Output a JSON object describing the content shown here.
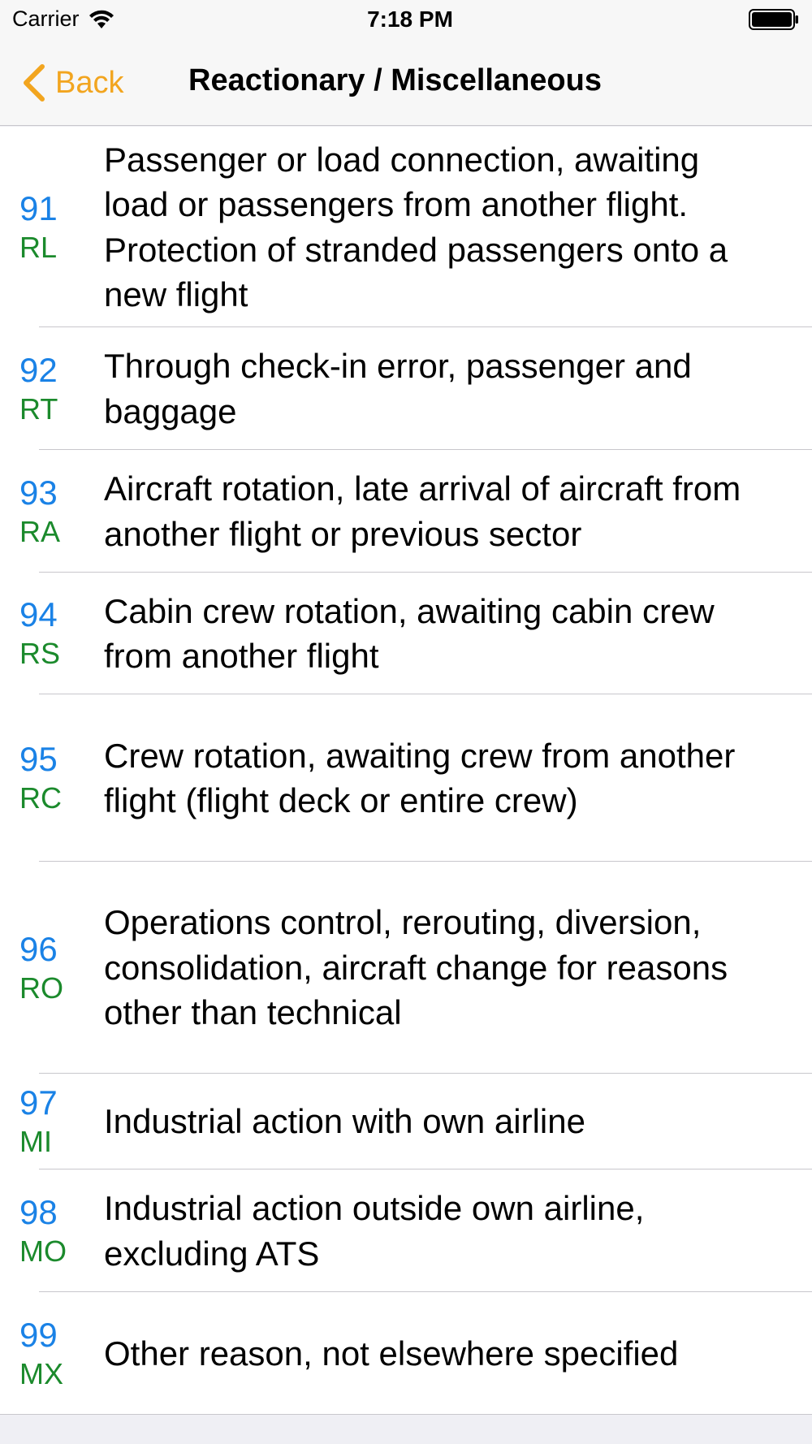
{
  "status_bar": {
    "carrier": "Carrier",
    "time": "7:18 PM",
    "icons": [
      "wifi-icon",
      "battery-icon"
    ]
  },
  "nav": {
    "back_label": "Back",
    "title": "Reactionary / Miscellaneous",
    "accent_color": "#f2a51f"
  },
  "colors": {
    "code_number": "#1a82e6",
    "code_abbr": "#1b8a2c"
  },
  "items": [
    {
      "code": "91",
      "abbr": "RL",
      "text": "Passenger or load connection, awaiting load or passengers from another flight. Protection of stranded passengers onto a new flight"
    },
    {
      "code": "92",
      "abbr": "RT",
      "text": "Through check-in error, passenger and baggage"
    },
    {
      "code": "93",
      "abbr": "RA",
      "text": "Aircraft rotation, late arrival of aircraft from another flight or previous sector"
    },
    {
      "code": "94",
      "abbr": "RS",
      "text": "Cabin crew rotation, awaiting cabin crew from another flight"
    },
    {
      "code": "95",
      "abbr": "RC",
      "text": "Crew rotation, awaiting crew from another flight (flight deck or entire crew)"
    },
    {
      "code": "96",
      "abbr": "RO",
      "text": "Operations control, rerouting, diversion, consolidation, aircraft change for reasons other than technical"
    },
    {
      "code": "97",
      "abbr": "MI",
      "text": "Industrial action with own airline"
    },
    {
      "code": "98",
      "abbr": "MO",
      "text": "Industrial action outside own airline, excluding ATS"
    },
    {
      "code": "99",
      "abbr": "MX",
      "text": "Other reason, not elsewhere specified"
    }
  ]
}
